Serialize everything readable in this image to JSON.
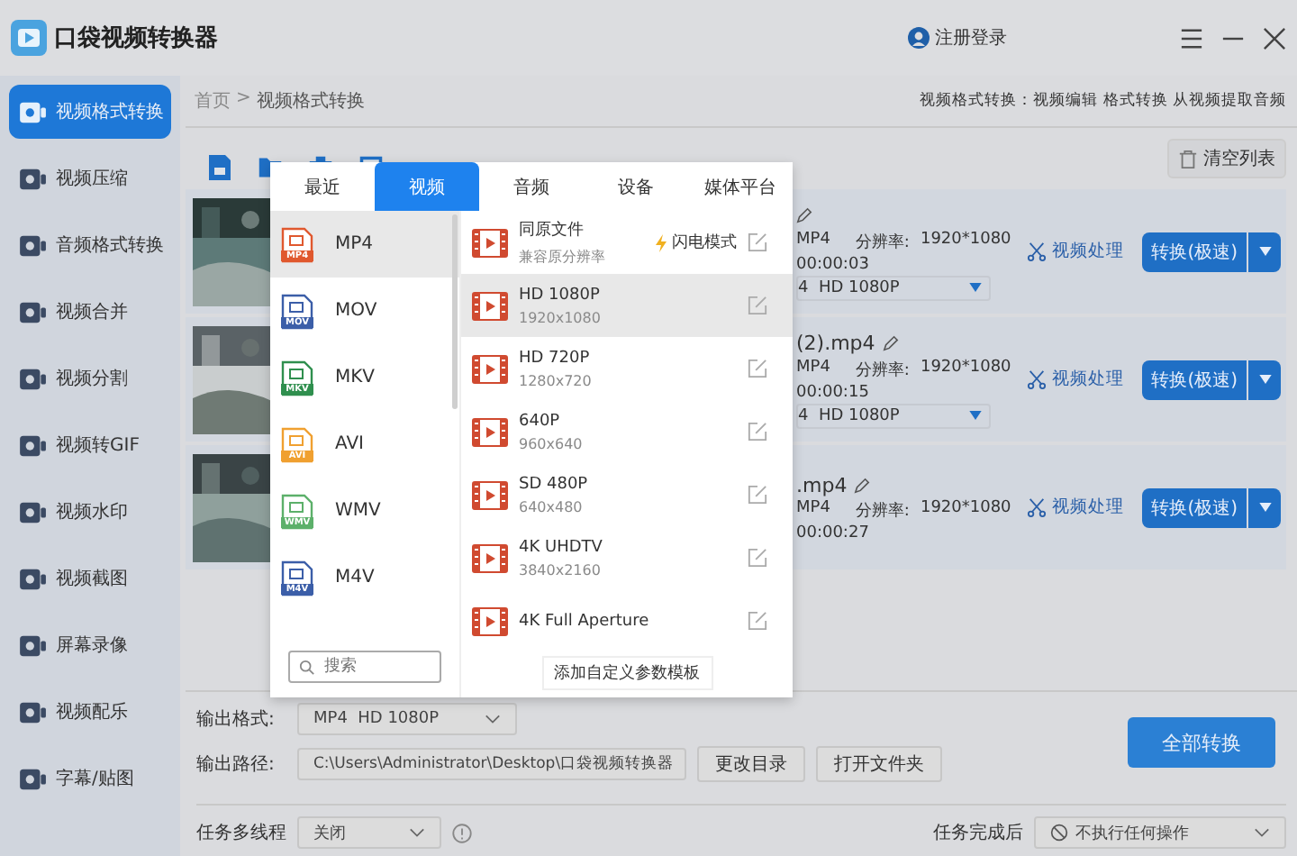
{
  "app": {
    "title": "口袋视频转换器",
    "login": "注册登录"
  },
  "sidebar": {
    "items": [
      {
        "label": "视频格式转换",
        "selected": true
      },
      {
        "label": "视频压缩",
        "selected": false
      },
      {
        "label": "音频格式转换",
        "selected": false
      },
      {
        "label": "视频合并",
        "selected": false
      },
      {
        "label": "视频分割",
        "selected": false
      },
      {
        "label": "视频转GIF",
        "selected": false
      },
      {
        "label": "视频水印",
        "selected": false
      },
      {
        "label": "视频截图",
        "selected": false
      },
      {
        "label": "屏幕录像",
        "selected": false
      },
      {
        "label": "视频配乐",
        "selected": false
      },
      {
        "label": "字幕/贴图",
        "selected": false
      }
    ]
  },
  "breadcrumb": {
    "items": [
      "首页",
      "视频格式转换"
    ],
    "separator": ">"
  },
  "tip": "视频格式转换：视频编辑 格式转换 从视频提取音频",
  "toolbar": {
    "clear_button": "清空列表"
  },
  "files": [
    {
      "format": "MP4",
      "resolution_label": "分辨率:",
      "resolution": "1920*1080",
      "duration": "00:00:03",
      "output": "4  HD 1080P",
      "process_link": "视频处理",
      "convert_button": "转换(极速)"
    },
    {
      "name": "(2).mp4",
      "format": "MP4",
      "resolution_label": "分辨率:",
      "resolution": "1920*1080",
      "duration": "00:00:15",
      "output": "4  HD 1080P",
      "process_link": "视频处理",
      "convert_button": "转换(极速)"
    },
    {
      "name": ".mp4",
      "format": "MP4",
      "resolution_label": "分辨率:",
      "resolution": "1920*1080",
      "duration": "00:00:27",
      "process_link": "视频处理",
      "convert_button": "转换(极速)"
    }
  ],
  "popup": {
    "tabs": [
      {
        "label": "最近",
        "selected": false
      },
      {
        "label": "视频",
        "selected": true
      },
      {
        "label": "音频",
        "selected": false
      },
      {
        "label": "设备",
        "selected": false
      },
      {
        "label": "媒体平台",
        "selected": false
      }
    ],
    "formats": [
      {
        "label": "MP4",
        "icon_text": "MP4",
        "color": "#e0582e",
        "selected": true
      },
      {
        "label": "MOV",
        "icon_text": "MOV",
        "color": "#3b5ea8",
        "selected": false
      },
      {
        "label": "MKV",
        "icon_text": "MKV",
        "color": "#2f8f4e",
        "selected": false
      },
      {
        "label": "AVI",
        "icon_text": "AVI",
        "color": "#f0a030",
        "selected": false
      },
      {
        "label": "WMV",
        "icon_text": "WMV",
        "color": "#5cb06a",
        "selected": false
      },
      {
        "label": "M4V",
        "icon_text": "M4V",
        "color": "#3b5ea8",
        "selected": false
      }
    ],
    "search": {
      "placeholder": "搜索"
    },
    "presets": [
      {
        "title": "同原文件",
        "subtitle": "兼容原分辨率",
        "badge": "闪电模式",
        "selected": false
      },
      {
        "title": "HD 1080P",
        "subtitle": "1920x1080",
        "selected": true
      },
      {
        "title": "HD 720P",
        "subtitle": "1280x720",
        "selected": false
      },
      {
        "title": "640P",
        "subtitle": "960x640",
        "selected": false
      },
      {
        "title": "SD 480P",
        "subtitle": "640x480",
        "selected": false
      },
      {
        "title": "4K UHDTV",
        "subtitle": "3840x2160",
        "selected": false
      },
      {
        "title": "4K Full Aperture",
        "selected": false
      }
    ],
    "add_button": "添加自定义参数模板"
  },
  "bottom": {
    "output_format_label": "输出格式:",
    "output_format": "MP4  HD 1080P",
    "output_path_label": "输出路径:",
    "output_path": "C:\\Users\\Administrator\\Desktop\\口袋视频转换器",
    "change_dir": "更改目录",
    "open_folder": "打开文件夹",
    "convert_all": "全部转换",
    "threads_label": "任务多线程",
    "threads": "关闭",
    "after_label": "任务完成后",
    "after": "不执行任何操作"
  }
}
